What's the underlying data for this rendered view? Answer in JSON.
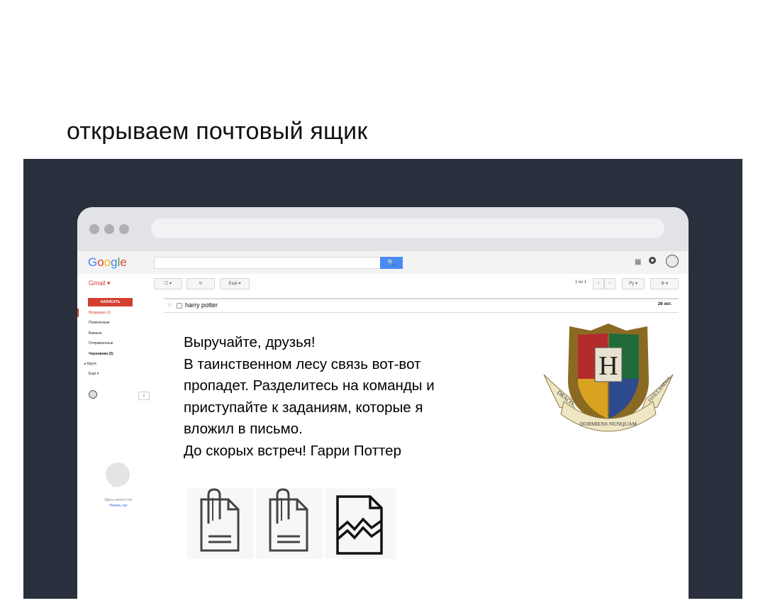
{
  "slide": {
    "title": "открываем почтовый ящик"
  },
  "gmail": {
    "logo": "Google",
    "label": "Gmail ▾",
    "search_button": "🔍",
    "compose": "НАПИСАТЬ",
    "nav": [
      "Входящие (1)",
      "Помеченные",
      "Важные",
      "Отправленные",
      "Черновики (5)",
      "▸ Круги",
      "Ещё ▾"
    ],
    "toolbar": {
      "select": "☐ ▾",
      "refresh": "↻",
      "more": "Ещё ▾"
    },
    "pager": {
      "count": "1 из 1",
      "prev": "‹",
      "next": "›",
      "lang": "Ру ▾",
      "settings": "⚙ ▾"
    },
    "chat": {
      "empty": "Здесь ничего нет",
      "start": "Начать чат"
    }
  },
  "message": {
    "subject": "harry potter",
    "date": "26 окт.",
    "lines": [
      "Выручайте, друзья!",
      "В таинственном лесу связь вот-вот",
      "пропадет. Разделитесь на команды и",
      "приступайте к заданиям, которые я",
      "вложил в письмо.",
      "До скорых встреч! Гарри Поттер"
    ],
    "crest": {
      "banner_left": "DRACO",
      "banner_middle": "DORMIENS NUNQUAM",
      "banner_right": "TITILLANDUS",
      "center_letter": "H"
    },
    "attachments": [
      "attachment-icon",
      "attachment-icon",
      "broken-file-icon"
    ]
  },
  "colors": {
    "dark_panel": "#2a2f3d",
    "gmail_red": "#d23f31",
    "search_blue": "#4a8af4"
  }
}
